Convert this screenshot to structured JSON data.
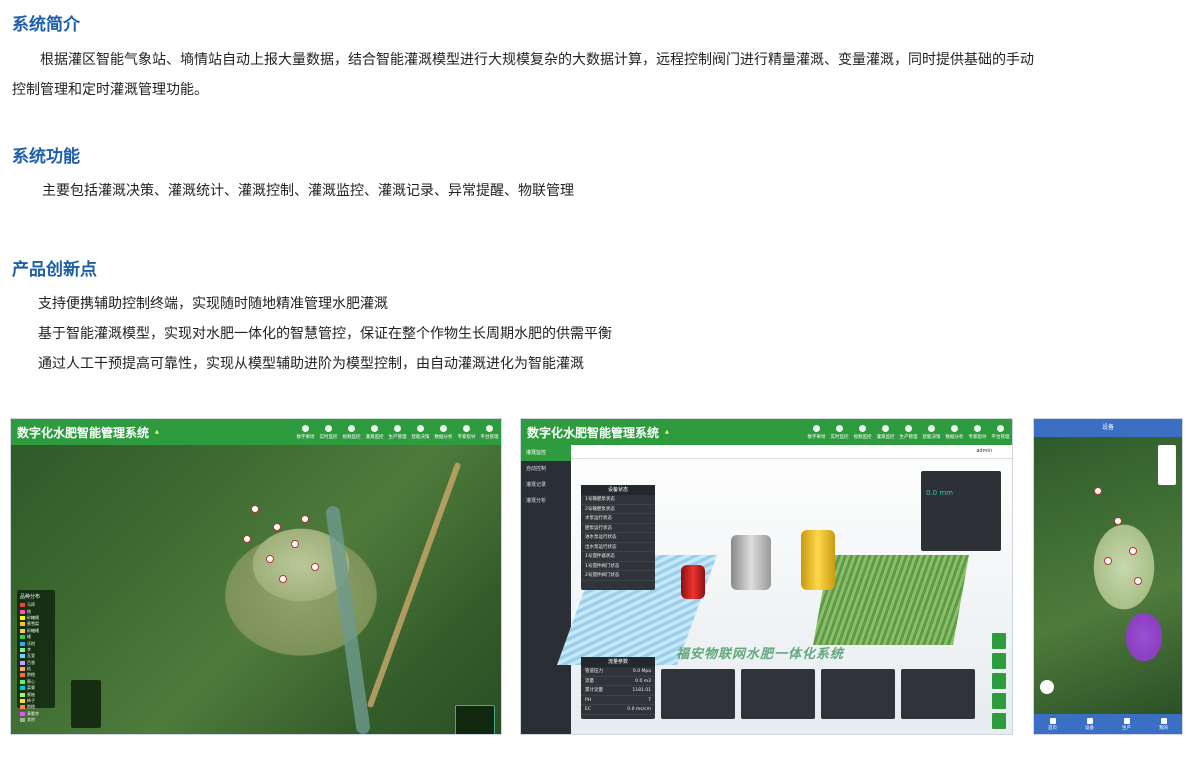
{
  "sections": {
    "intro": {
      "title": "系统简介",
      "text": "根据灌区智能气象站、墒情站自动上报大量数据，结合智能灌溉模型进行大规模复杂的大数据计算，远程控制阀门进行精量灌溉、变量灌溉，同时提供基础的手动控制管理和定时灌溉管理功能。",
      "line1": "根据灌区智能气象站、墒情站自动上报大量数据，结合智能灌溉模型进行大规模复杂的大数据计算，远程控制阀门进行精量灌溉、变量灌溉，同时提供基础的手动",
      "line2": "控制管理和定时灌溉管理功能。"
    },
    "functions": {
      "title": "系统功能",
      "text": "主要包括灌溉决策、灌溉统计、灌溉控制、灌溉监控、灌溉记录、异常提醒、物联管理"
    },
    "innovation": {
      "title": "产品创新点",
      "points": [
        "支持便携辅助控制终端，实现随时随地精准管理水肥灌溉",
        "基于智能灌溉模型，实现对水肥一体化的智慧管控，保证在整个作物生长周期水肥的供需平衡",
        "通过人工干预提高可靠性，实现从模型辅助进阶为模型控制，由自动灌溉进化为智能灌溉"
      ]
    }
  },
  "screenshots": {
    "system_title": "数字化水肥智能管理系统",
    "nav": [
      "数字果场",
      "实时监控",
      "视频监控",
      "灌溉监控",
      "生产管理",
      "智能决策",
      "数据分析",
      "专家指导",
      "平台管理"
    ],
    "map_legend": {
      "title": "品种分布",
      "items": [
        "马蹄",
        "桃",
        "砂糖橘",
        "蜜雪梨",
        "砂糖橘",
        "橘",
        "沃柑",
        "李",
        "瓦瓷",
        "百香",
        "桔",
        "脐橙",
        "蜜心",
        "菜薹",
        "蜜柚",
        "柿子",
        "脐橙",
        "青脆李",
        "其他"
      ],
      "colors": [
        "#e43",
        "#f5a",
        "#ff0",
        "#fb3",
        "#ec6",
        "#4c4",
        "#3af",
        "#8e8",
        "#7cf",
        "#c9f",
        "#fa6",
        "#f64",
        "#6e6",
        "#0cc",
        "#9f6",
        "#fd4",
        "#f84",
        "#d5f",
        "#aaa"
      ]
    },
    "sidebar": [
      "灌溉监控",
      "自动控制",
      "灌溉记录",
      "灌溉分析"
    ],
    "status_panel": {
      "title": "设备状态",
      "rows": [
        "1号输肥泵状态",
        "2号输肥泵状态",
        "水泵运行状态",
        "肥泵运行状态",
        "进水泵运行状态",
        "出水泵运行状态",
        "1号搅拌器状态",
        "1号搅拌阀门状态",
        "2号搅拌阀门状态"
      ]
    },
    "params_panel": {
      "title": "流量参数",
      "rows": [
        [
          "管道压力",
          "0.0 Mpa"
        ],
        [
          "流量",
          "0.0 m3"
        ],
        [
          "累计流量",
          "1181.01"
        ],
        [
          "PH",
          "7"
        ],
        [
          "EC",
          "0.0 ms/cm"
        ]
      ]
    },
    "scene_label": "福安物联网水肥一体化系统",
    "weather": {
      "value": "0.0 mm",
      "unit": "mm/d"
    },
    "user": "admin",
    "mobile": {
      "title": "设备",
      "tabs": [
        "首页",
        "设备",
        "生产",
        "我的"
      ]
    }
  }
}
